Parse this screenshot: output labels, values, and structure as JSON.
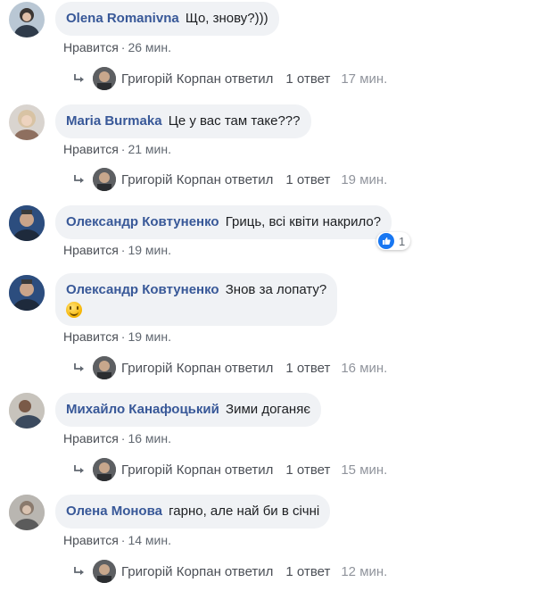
{
  "like_label": "Нравится",
  "reply_label": "ответил",
  "reply_count_label": "1 ответ",
  "replier_name": "Григорій Корпан",
  "colors": {
    "author": "#385898",
    "bubble": "#f0f2f5",
    "meta": "#606770",
    "like_blue": "#1877f2"
  },
  "comments": [
    {
      "author": "Olena Romanivna",
      "text": "Що, знову?)))",
      "time": "26 мин.",
      "reply_time": "17 мин."
    },
    {
      "author": "Maria Burmaka",
      "text": "Це у вас там таке???",
      "time": "21 мин.",
      "reply_time": "19 мин."
    },
    {
      "author": "Олександр Ковтуненко",
      "text": "Гриць, всі квіти накрило?",
      "time": "19 мин.",
      "reaction_count": "1"
    },
    {
      "author": "Олександр Ковтуненко",
      "text": "Знов за лопату?",
      "time": "19 мин.",
      "reply_time": "16 мин.",
      "emoji": "smile-emoji"
    },
    {
      "author": "Михайло Канафоцький",
      "text": "Зими доганяє",
      "time": "16 мин.",
      "reply_time": "15 мин."
    },
    {
      "author": "Олена Монова",
      "text": "гарно, але най би в січні",
      "time": "14 мин.",
      "reply_time": "12 мин."
    }
  ]
}
